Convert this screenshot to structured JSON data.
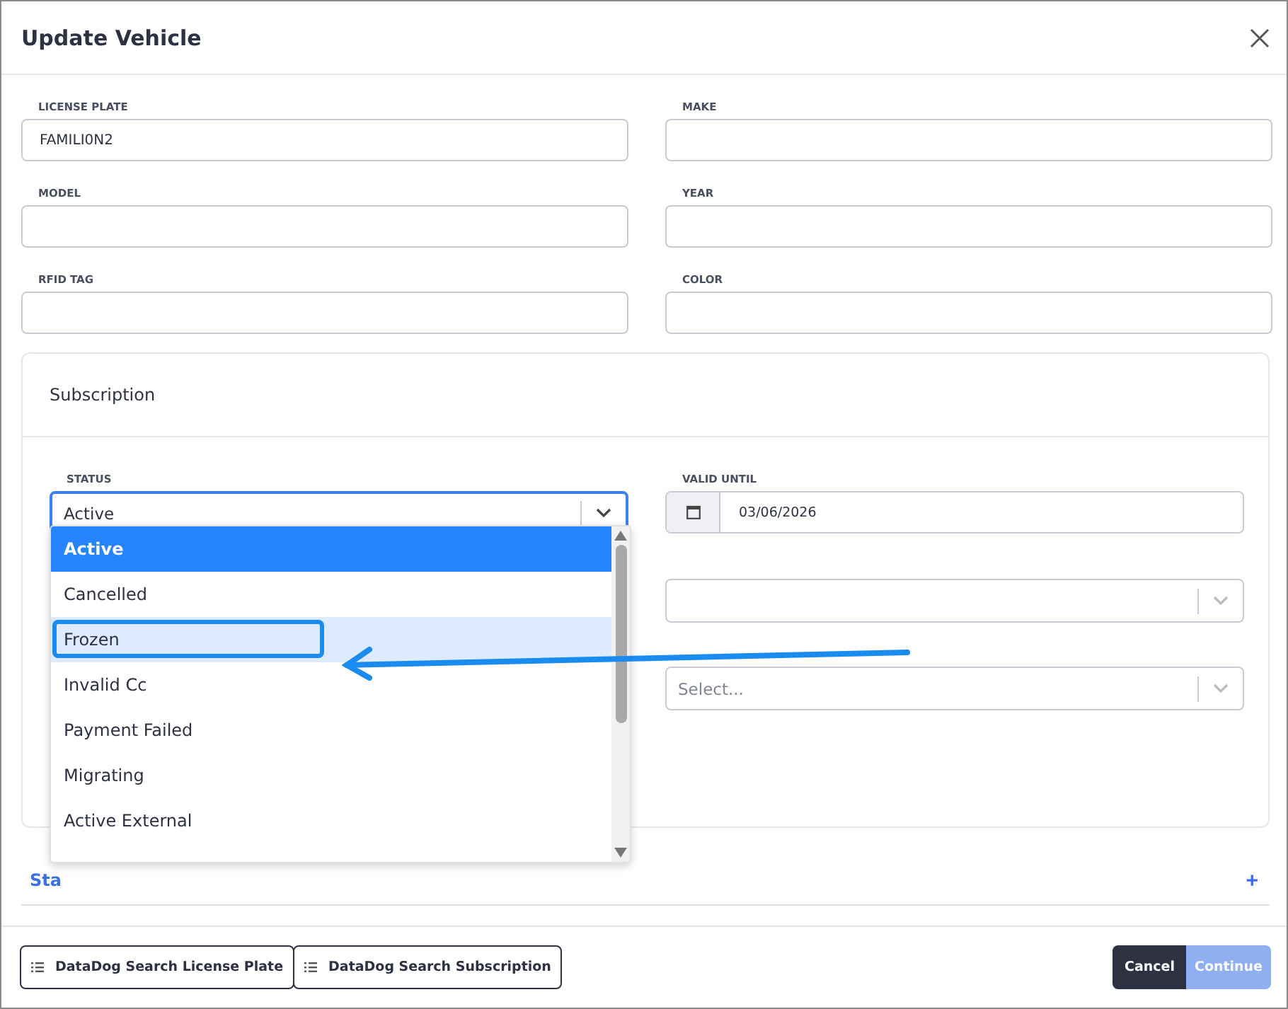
{
  "dialog": {
    "title": "Update Vehicle"
  },
  "vehicle_fields": [
    {
      "label": "LICENSE PLATE",
      "value": "FAMILI0N2"
    },
    {
      "label": "MAKE"
    },
    {
      "label": "MODEL"
    },
    {
      "label": "YEAR"
    },
    {
      "label": "RFID TAG"
    },
    {
      "label": "COLOR"
    }
  ],
  "subscription": {
    "title": "Subscription",
    "status": {
      "label": "STATUS",
      "value": "Active",
      "expanded": true,
      "options": [
        {
          "label": "Active",
          "selected": true,
          "hovered": false,
          "annotated": false
        },
        {
          "label": "Cancelled",
          "selected": false,
          "hovered": false,
          "annotated": false
        },
        {
          "label": "Frozen",
          "selected": false,
          "hovered": true,
          "annotated": true
        },
        {
          "label": "Invalid Cc",
          "selected": false,
          "hovered": false,
          "annotated": false
        },
        {
          "label": "Payment Failed",
          "selected": false,
          "hovered": false,
          "annotated": false
        },
        {
          "label": "Migrating",
          "selected": false,
          "hovered": false,
          "annotated": false
        },
        {
          "label": "Active External",
          "selected": false,
          "hovered": false,
          "annotated": false
        }
      ]
    },
    "valid_until": {
      "label": "VALID UNTIL",
      "value": "03/06/2026"
    },
    "promotion": {
      "placeholder": "Select..."
    }
  },
  "section": {
    "title": "Sta",
    "expand": "+"
  },
  "footer": {
    "left_buttons": [
      "DataDog Search License Plate",
      "DataDog Search Subscription"
    ],
    "cancel": "Cancel",
    "continue": {
      "label": "Continue",
      "disabled": true
    }
  }
}
